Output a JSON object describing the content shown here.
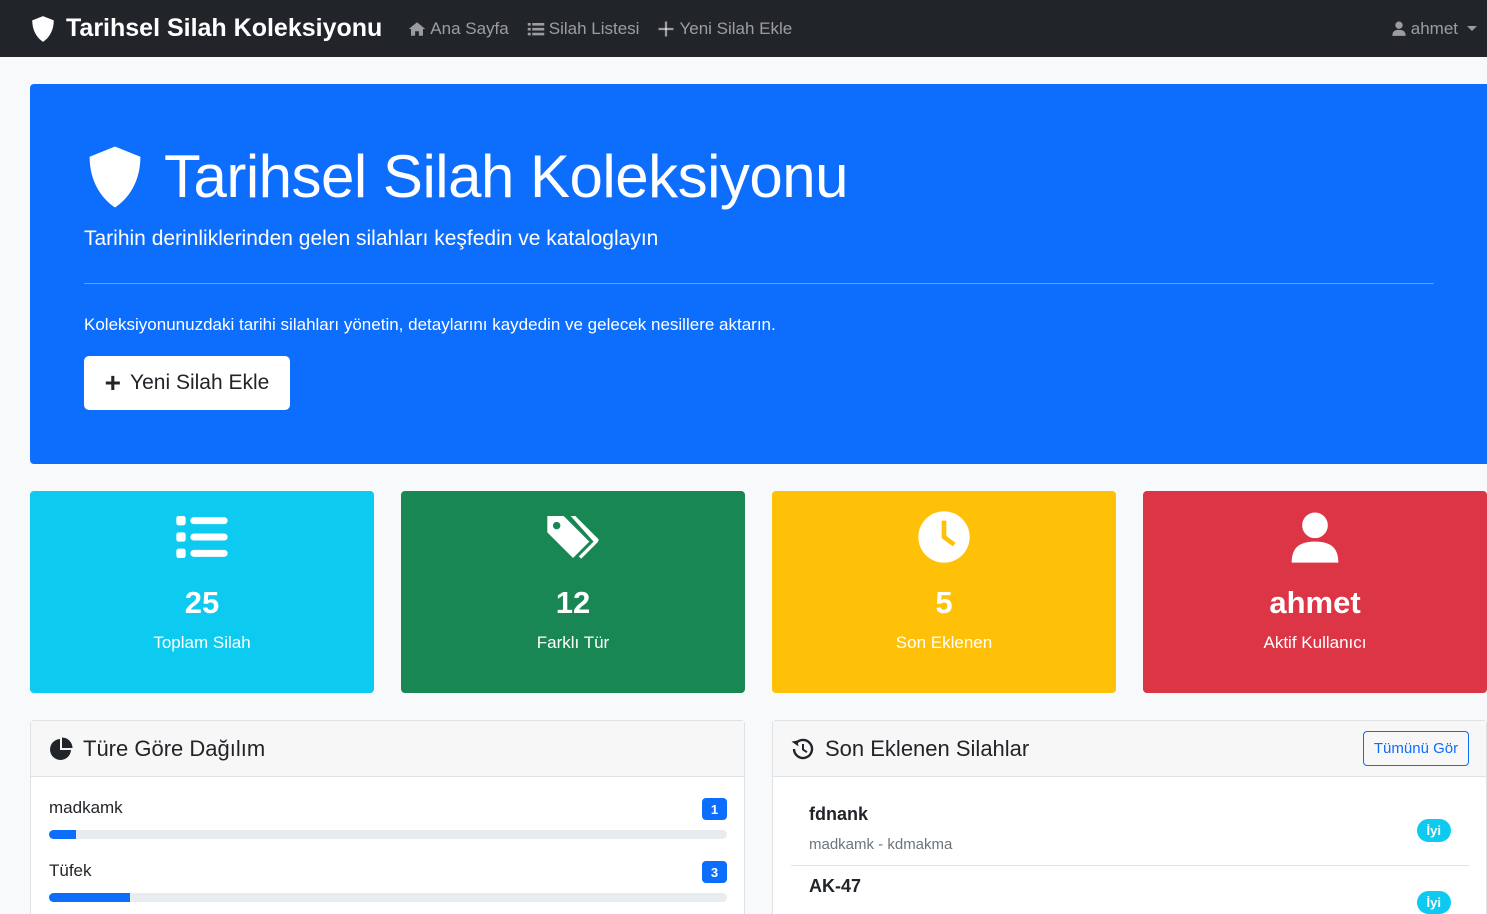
{
  "navbar": {
    "brand": "Tarihsel Silah Koleksiyonu",
    "links": [
      {
        "label": "Ana Sayfa",
        "icon": "home-icon"
      },
      {
        "label": "Silah Listesi",
        "icon": "list-icon"
      },
      {
        "label": "Yeni Silah Ekle",
        "icon": "plus-icon"
      }
    ],
    "user": "ahmet"
  },
  "hero": {
    "title": "Tarihsel Silah Koleksiyonu",
    "subtitle": "Tarihin derinliklerinden gelen silahları keşfedin ve kataloglayın",
    "text": "Koleksiyonunuzdaki tarihi silahları yönetin, detaylarını kaydedin ve gelecek nesillere aktarın.",
    "button_label": "Yeni Silah Ekle"
  },
  "stats": [
    {
      "value": "25",
      "label": "Toplam Silah",
      "icon": "list-icon",
      "color": "#0dcaf0"
    },
    {
      "value": "12",
      "label": "Farklı Tür",
      "icon": "tags-icon",
      "color": "#198754"
    },
    {
      "value": "5",
      "label": "Son Eklenen",
      "icon": "clock-icon",
      "color": "#ffc107"
    },
    {
      "value": "ahmet",
      "label": "Aktif Kullanıcı",
      "icon": "user-icon",
      "color": "#dc3545"
    }
  ],
  "distribution": {
    "title": "Türe Göre Dağılım",
    "items": [
      {
        "label": "madkamk",
        "count": "1",
        "fraction": 0.04
      },
      {
        "label": "Tüfek",
        "count": "3",
        "fraction": 0.12
      }
    ]
  },
  "recent": {
    "title": "Son Eklenen Silahlar",
    "view_all": "Tümünü Gör",
    "items": [
      {
        "name": "fdnank",
        "meta": "madkamk - kdmakma",
        "condition": "İyi"
      },
      {
        "name": "AK-47",
        "meta": "",
        "condition": "İyi"
      }
    ]
  },
  "colors": {
    "primary": "#0d6efd",
    "navbar": "#212529"
  }
}
